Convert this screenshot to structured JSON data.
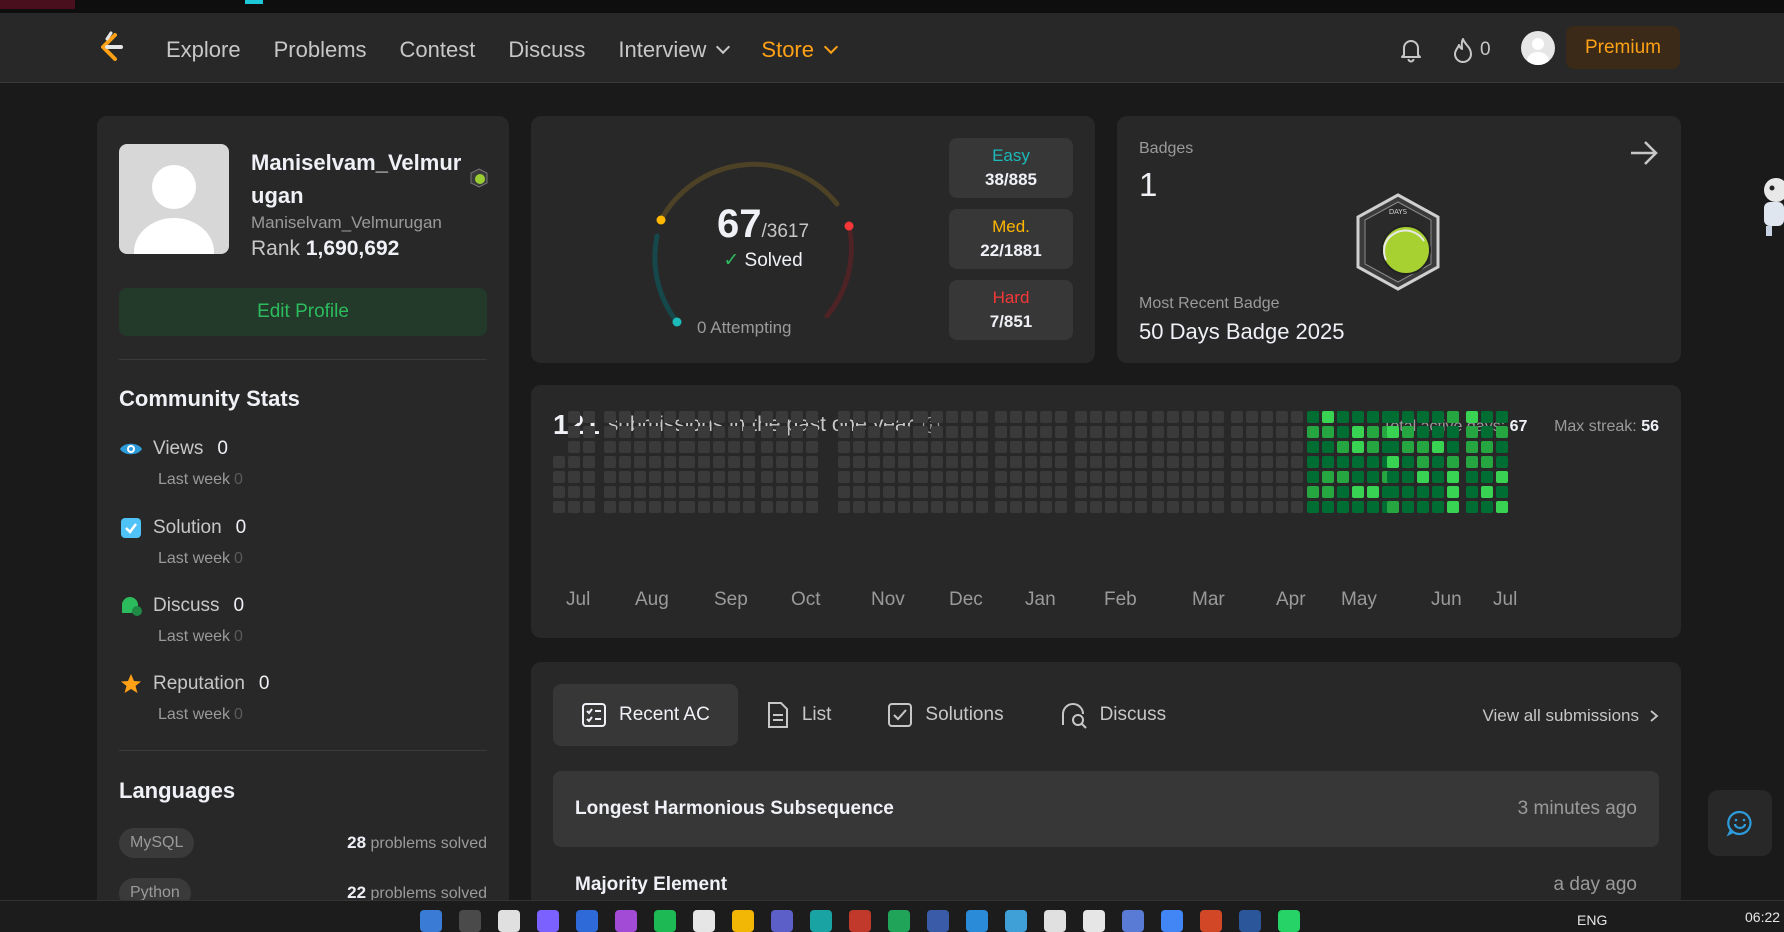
{
  "nav": {
    "items": [
      "Explore",
      "Problems",
      "Contest",
      "Discuss",
      "Interview",
      "Store"
    ],
    "streak": "0",
    "premium": "Premium"
  },
  "profile": {
    "name": "Maniselvam_Velmurugan",
    "handle": "Maniselvam_Velmurugan",
    "rank_label": "Rank",
    "rank": "1,690,692",
    "edit": "Edit Profile"
  },
  "community": {
    "title": "Community Stats",
    "stats": [
      {
        "label": "Views",
        "value": "0",
        "last_label": "Last week",
        "last": "0",
        "icon": "eye-icon",
        "color": "#2d9cdb"
      },
      {
        "label": "Solution",
        "value": "0",
        "last_label": "Last week",
        "last": "0",
        "icon": "checkbox-icon",
        "color": "#4fc3f7"
      },
      {
        "label": "Discuss",
        "value": "0",
        "last_label": "Last week",
        "last": "0",
        "icon": "discuss-icon",
        "color": "#2cbb5d"
      },
      {
        "label": "Reputation",
        "value": "0",
        "last_label": "Last week",
        "last": "0",
        "icon": "star-icon",
        "color": "#ffa116"
      }
    ]
  },
  "languages": {
    "title": "Languages",
    "items": [
      {
        "name": "MySQL",
        "count": "28",
        "suffix": "problems solved"
      },
      {
        "name": "Python",
        "count": "22",
        "suffix": "problems solved"
      }
    ]
  },
  "solved": {
    "count": "67",
    "total": "/3617",
    "label": "Solved",
    "attempting": "0 Attempting",
    "easy": {
      "label": "Easy",
      "value": "38/885",
      "color": "#1cbaba"
    },
    "medium": {
      "label": "Med.",
      "value": "22/1881",
      "color": "#ffb700"
    },
    "hard": {
      "label": "Hard",
      "value": "7/851",
      "color": "#f63737"
    }
  },
  "badges": {
    "title": "Badges",
    "count": "1",
    "badge_text": "DAYS",
    "recent_label": "Most Recent Badge",
    "recent_name": "50 Days Badge 2025"
  },
  "heatmap": {
    "count": "121",
    "text": "submissions in the past one year",
    "active_label": "Total active days:",
    "active": "67",
    "streak_label": "Max streak:",
    "streak": "56",
    "months": [
      "Jul",
      "Aug",
      "Sep",
      "Oct",
      "Nov",
      "Dec",
      "Jan",
      "Feb",
      "Mar",
      "Apr",
      "May",
      "Jun",
      "Jul"
    ]
  },
  "submissions": {
    "tabs": [
      "Recent AC",
      "List",
      "Solutions",
      "Discuss"
    ],
    "view_all": "View all submissions",
    "rows": [
      {
        "name": "Longest Harmonious Subsequence",
        "time": "3 minutes ago"
      },
      {
        "name": "Majority Element",
        "time": "a day ago"
      }
    ]
  },
  "taskbar": {
    "lang": "ENG",
    "time": "06:22"
  }
}
